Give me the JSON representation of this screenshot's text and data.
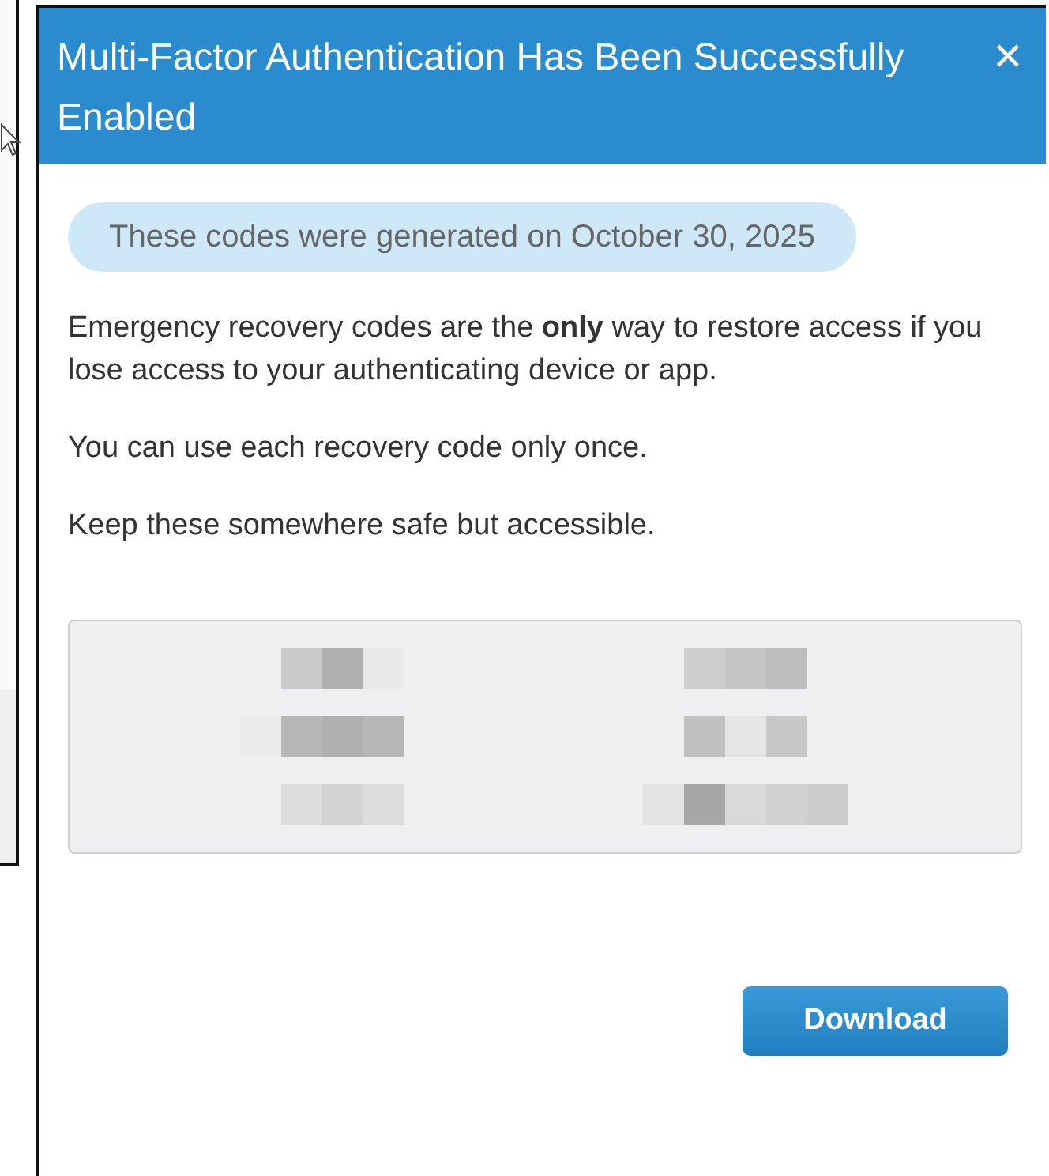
{
  "dialog": {
    "title": "Multi-Factor Authentication Has Been Successfully Enabled",
    "close_label": "✕",
    "generated_notice": "These codes were generated on October 30, 2025",
    "paragraphs": [
      "Emergency recovery codes are the **only** way to restore access if you lose access to your authenticating device or app.",
      "You can use each recovery code only once.",
      "Keep these somewhere safe but accessible."
    ],
    "recovery_codes": [
      {
        "kind": "redacted"
      },
      {
        "kind": "redacted"
      },
      {
        "kind": "redacted"
      },
      {
        "kind": "redacted"
      },
      {
        "kind": "redacted"
      },
      {
        "kind": "redacted"
      }
    ],
    "download_button": "Download"
  }
}
